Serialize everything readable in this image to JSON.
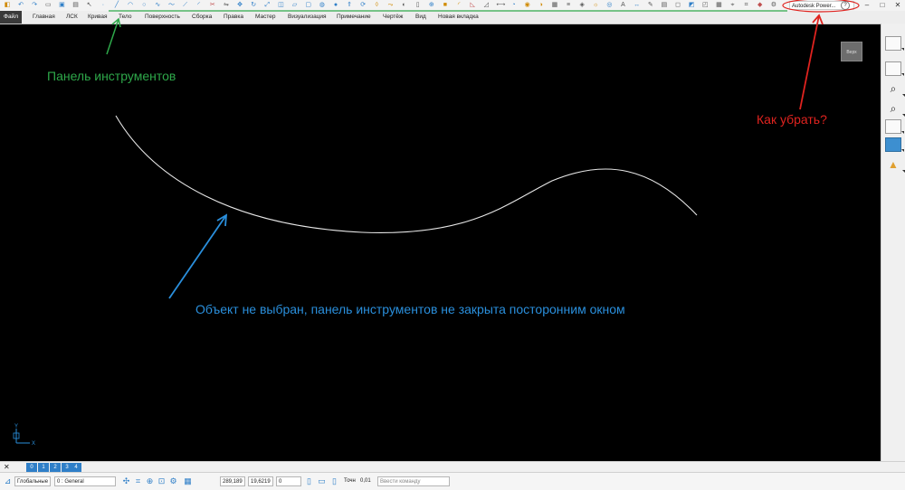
{
  "toolbar": {
    "title": "Autodesk Power...",
    "help": "?",
    "window": {
      "minimize": "–",
      "restore": "□",
      "close": "✕"
    },
    "icons": [
      "new-icon",
      "undo-icon",
      "redo-icon",
      "copy-icon",
      "save-icon",
      "print-icon",
      "select-icon",
      "point-icon",
      "line-icon",
      "arc-icon",
      "circle-icon",
      "curve-icon",
      "spline-icon",
      "offset-icon",
      "fillet-icon",
      "trim-icon",
      "mirror-icon",
      "move-icon",
      "rotate-icon",
      "scale-icon",
      "surface-icon",
      "plane-icon",
      "box-icon",
      "cylinder-icon",
      "sphere-icon",
      "extrude-icon",
      "revolve-icon",
      "loft-icon",
      "sweep-icon",
      "blend-icon",
      "shell-icon",
      "boolean-icon",
      "solid-icon",
      "fillet-solid-icon",
      "chamfer-icon",
      "draft-icon",
      "measure-icon",
      "analyze-icon",
      "render-icon",
      "shade-icon",
      "wireframe-icon",
      "layer-icon",
      "material-icon",
      "light-icon",
      "camera-icon",
      "text-icon",
      "dimension-icon",
      "annotation-icon",
      "drawing-icon",
      "view-icon",
      "section-icon",
      "clip-icon",
      "grid-icon",
      "snap-icon",
      "workplane-icon",
      "macro-icon",
      "settings-icon"
    ]
  },
  "tabs": [
    "Файл",
    "Главная",
    "ЛСК",
    "Кривая",
    "Тело",
    "Поверхность",
    "Сборка",
    "Правка",
    "Мастер",
    "Визуализация",
    "Примечание",
    "Чертёж",
    "Вид",
    "Новая вкладка"
  ],
  "annotations": {
    "toolbar_label": "Панель инструментов",
    "question": "Как убрать?",
    "note": "Объект не выбран, панель инструментов не закрыта посторонним окном"
  },
  "colors": {
    "green": "#2ea84a",
    "red": "#e0231f",
    "blue": "#2a8fdc",
    "curve": "#e6e6e6",
    "active_tab": "#3a3a3a"
  },
  "viewport": {
    "viewcube_label": "Верх",
    "axis_x": "X",
    "axis_y": "Y"
  },
  "view_tabs": [
    "0",
    "1",
    "2",
    "3",
    "4"
  ],
  "status": {
    "close": "✕",
    "workplane": "Глобальные",
    "layer": "0 : General",
    "coord_x": "289,189",
    "coord_y": "19,6219",
    "coord_z": "0",
    "tolerance_label": "Точн",
    "tolerance_value": "0,01",
    "command_placeholder": "Ввести команду"
  },
  "right_toolbar": [
    "iso-view-icon",
    "view-cube-icon",
    "zoom-icon",
    "zoom-box-icon",
    "wireframe-view-icon",
    "shaded-view-icon",
    "light-icon"
  ]
}
